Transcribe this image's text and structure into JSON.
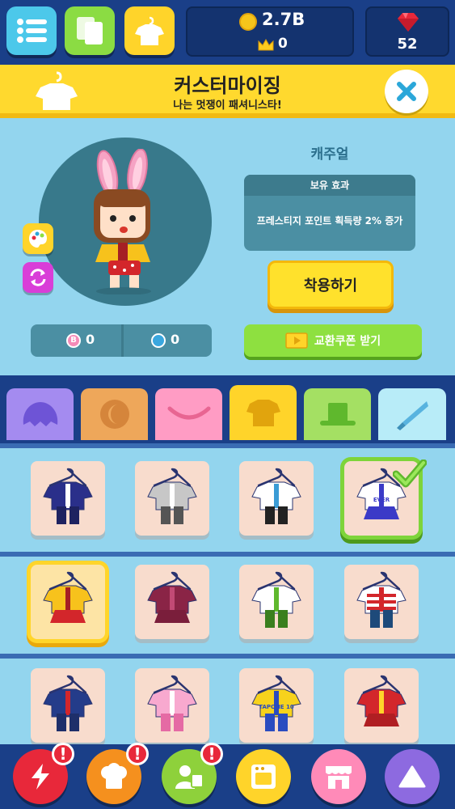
{
  "top_bar": {
    "gold": "2.7B",
    "crowns": "0",
    "gems": "52"
  },
  "header": {
    "title": "커스터마이징",
    "subtitle": "나는 멋쟁이 패셔니스타!"
  },
  "preview": {
    "costume_name": "캐주얼",
    "effect_title": "보유 효과",
    "effect_text": "프레스티지 포인트 획득량 2% 증가",
    "apply_label": "착용하기",
    "stat_b": "0",
    "stat_ring": "0",
    "coupon_label": "교환쿠폰 받기"
  },
  "tabs": [
    "hair-tab",
    "face-tab",
    "mouth-tab",
    "outfit-tab",
    "hat-tab",
    "accessory-tab"
  ],
  "active_tab": 3,
  "outfits": [
    {
      "name": "navy-suit",
      "badge": ""
    },
    {
      "name": "grey-hoodie",
      "badge": ""
    },
    {
      "name": "doctor-gown",
      "badge": ""
    },
    {
      "name": "cheer-uniform",
      "badge": "EVER"
    },
    {
      "name": "casual-cape",
      "badge": ""
    },
    {
      "name": "maroon-dress",
      "badge": ""
    },
    {
      "name": "green-school",
      "badge": ""
    },
    {
      "name": "striped-shirt",
      "badge": ""
    },
    {
      "name": "navy-robe",
      "badge": ""
    },
    {
      "name": "pink-bunny",
      "badge": ""
    },
    {
      "name": "soccer-jersey",
      "badge": "TAPONE 10"
    },
    {
      "name": "red-chinese",
      "badge": ""
    }
  ],
  "colors": {
    "accent": "#ffd92e",
    "panel": "#93d5ee",
    "nav": "#1a3f88"
  }
}
